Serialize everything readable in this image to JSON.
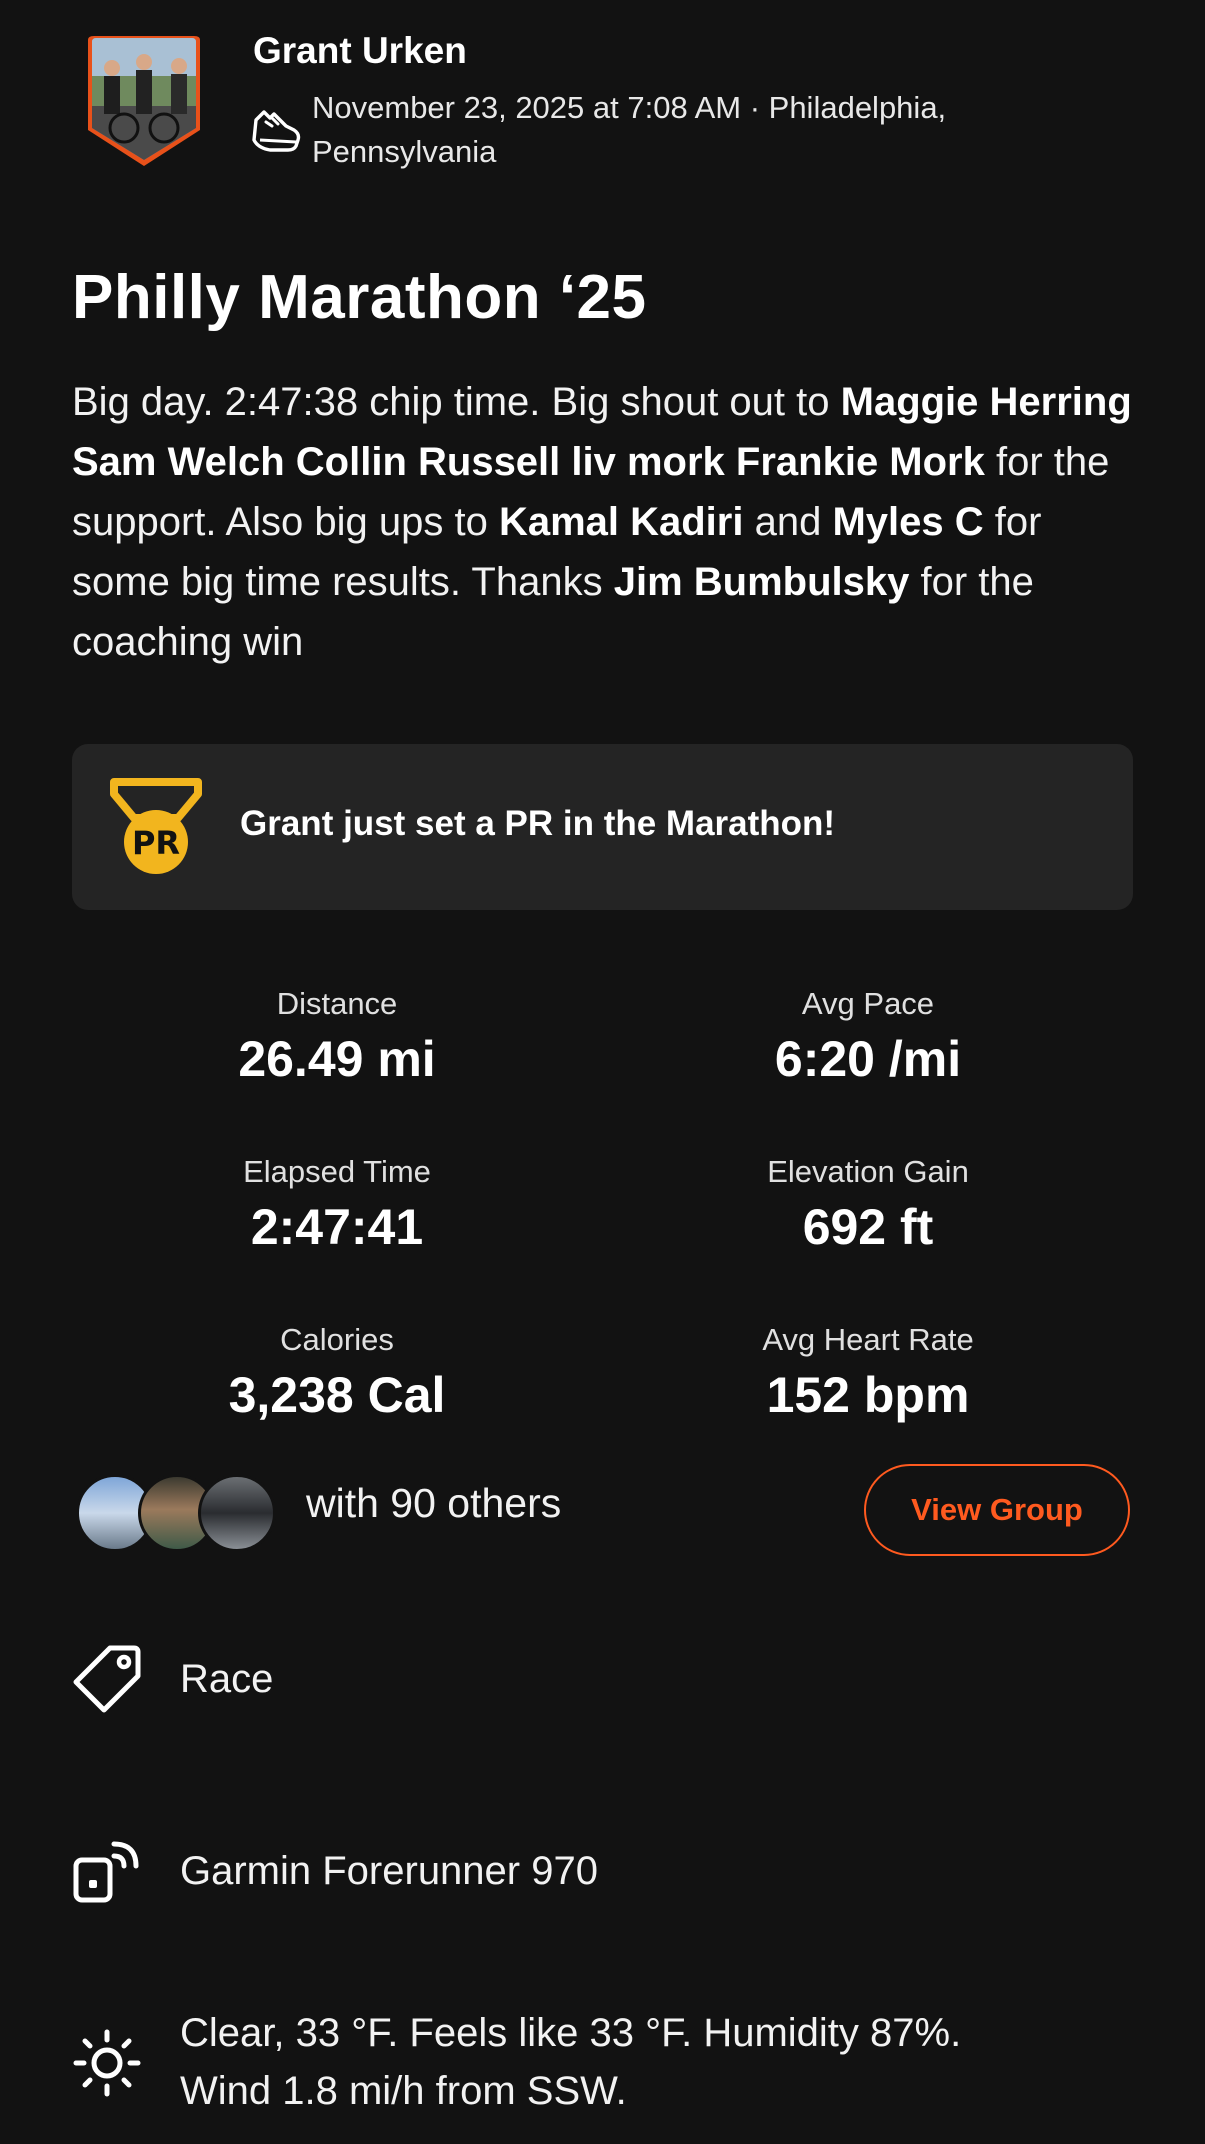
{
  "header": {
    "athlete_name": "Grant Urken",
    "date_location_line1": "November 23, 2025 at 7:08 AM · Philadelphia,",
    "date_location_line2": "Pennsylvania",
    "activity_type_icon": "running-shoe-icon"
  },
  "activity": {
    "title": "Philly Marathon ‘25",
    "description": {
      "p1": "Big day. 2:47:38 chip time. Big shout out to ",
      "m1": "Maggie Herring Sam Welch Collin Russell liv mork Frankie Mork",
      "p2": " for the support. Also big ups to ",
      "m2": "Kamal Kadiri",
      "p3": " and ",
      "m3": "Myles C",
      "p4": " for some big time results. Thanks ",
      "m4": "Jim Bumbulsky",
      "p5": " for the coaching win"
    }
  },
  "pr": {
    "badge_text": "PR",
    "message": "Grant just set a PR in the Marathon!",
    "badge_color": "#f2b51e"
  },
  "stats": [
    {
      "label": "Distance",
      "value": "26.49 mi"
    },
    {
      "label": "Avg Pace",
      "value": "6:20 /mi"
    },
    {
      "label": "Elapsed Time",
      "value": "2:47:41"
    },
    {
      "label": "Elevation Gain",
      "value": "692 ft"
    },
    {
      "label": "Calories",
      "value": "3,238 Cal"
    },
    {
      "label": "Avg Heart Rate",
      "value": "152 bpm"
    }
  ],
  "group": {
    "others_text": "with 90 others",
    "button_label": "View Group"
  },
  "details": {
    "tag": "Race",
    "device": "Garmin Forerunner 970",
    "weather_line1": "Clear, 33 °F. Feels like 33 °F. Humidity 87%.",
    "weather_line2": "Wind 1.8 mi/h from SSW."
  },
  "colors": {
    "accent": "#ff5a1f",
    "background": "#121212",
    "card": "#242424"
  }
}
